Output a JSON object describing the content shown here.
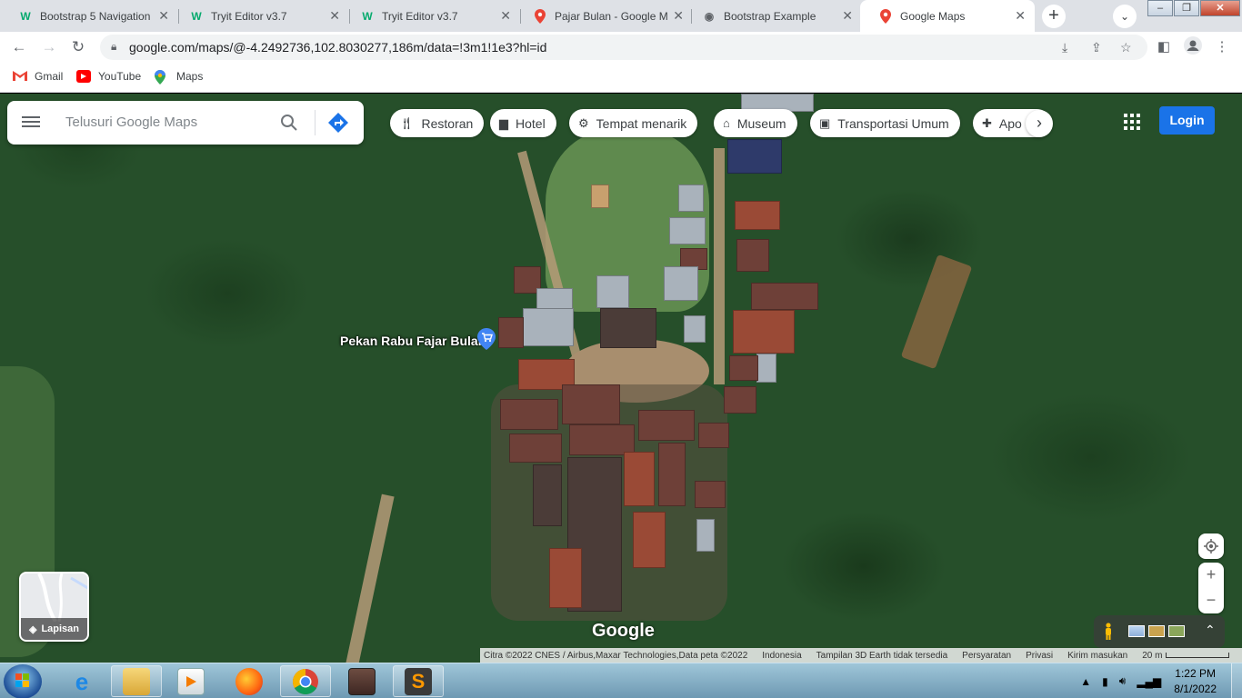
{
  "browser": {
    "tabs": [
      {
        "title": "Bootstrap 5 Navigation",
        "favicon": "w3schools-icon",
        "active": false
      },
      {
        "title": "Tryit Editor v3.7",
        "favicon": "w3schools-icon",
        "active": false
      },
      {
        "title": "Tryit Editor v3.7",
        "favicon": "w3schools-icon",
        "active": false
      },
      {
        "title": "Pajar Bulan - Google M",
        "favicon": "google-maps-icon",
        "active": false
      },
      {
        "title": "Bootstrap Example",
        "favicon": "globe-icon",
        "active": false
      },
      {
        "title": "Google Maps",
        "favicon": "google-maps-icon",
        "active": true
      }
    ],
    "url": "google.com/maps/@-4.2492736,102.8030277,186m/data=!3m1!1e3?hl=id",
    "bookmarks": [
      {
        "label": "Gmail",
        "icon": "gmail-icon"
      },
      {
        "label": "YouTube",
        "icon": "youtube-icon"
      },
      {
        "label": "Maps",
        "icon": "maps-icon"
      }
    ]
  },
  "maps": {
    "search_placeholder": "Telusuri Google Maps",
    "chips": [
      {
        "label": "Restoran",
        "icon": "restaurant-icon"
      },
      {
        "label": "Hotel",
        "icon": "hotel-icon"
      },
      {
        "label": "Tempat menarik",
        "icon": "attraction-icon"
      },
      {
        "label": "Museum",
        "icon": "museum-icon"
      },
      {
        "label": "Transportasi Umum",
        "icon": "transit-icon"
      },
      {
        "label": "Apo",
        "icon": "pharmacy-icon"
      }
    ],
    "login_label": "Login",
    "place_label": "Pekan Rabu Fajar Bulan",
    "layers_label": "Lapisan",
    "logo": "Google",
    "attribution": {
      "imagery": "Citra ©2022 CNES / Airbus,Maxar Technologies,Data peta ©2022",
      "country": "Indonesia",
      "earth_note": "Tampilan 3D Earth tidak tersedia",
      "terms": "Persyaratan",
      "privacy": "Privasi",
      "feedback": "Kirim masukan",
      "scale": "20 m"
    }
  },
  "taskbar": {
    "time": "1:22 PM",
    "date": "8/1/2022",
    "apps": [
      "windows-explorer",
      "internet-explorer",
      "file-explorer",
      "media-player",
      "firefox",
      "chrome",
      "game",
      "sublime-text"
    ]
  },
  "colors": {
    "accent": "#1a73e8",
    "tabbar": "#dee1e6"
  }
}
